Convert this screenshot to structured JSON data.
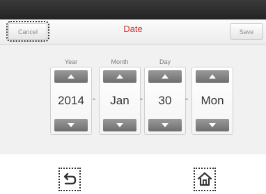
{
  "header": {
    "cancel_label": "Cancel",
    "title": "Date",
    "save_label": "Save"
  },
  "columns": [
    {
      "label": "Year",
      "value": "2014"
    },
    {
      "label": "Month",
      "value": "Jan"
    },
    {
      "label": "Day",
      "value": "30"
    },
    {
      "label": "",
      "value": "Mon"
    }
  ],
  "separator": "-",
  "nav": {
    "back_icon": "back-icon",
    "home_icon": "home-icon"
  },
  "colors": {
    "title": "#d8302f",
    "arrow": "#7a7a7a",
    "status_bar": "#2a2a2a"
  }
}
